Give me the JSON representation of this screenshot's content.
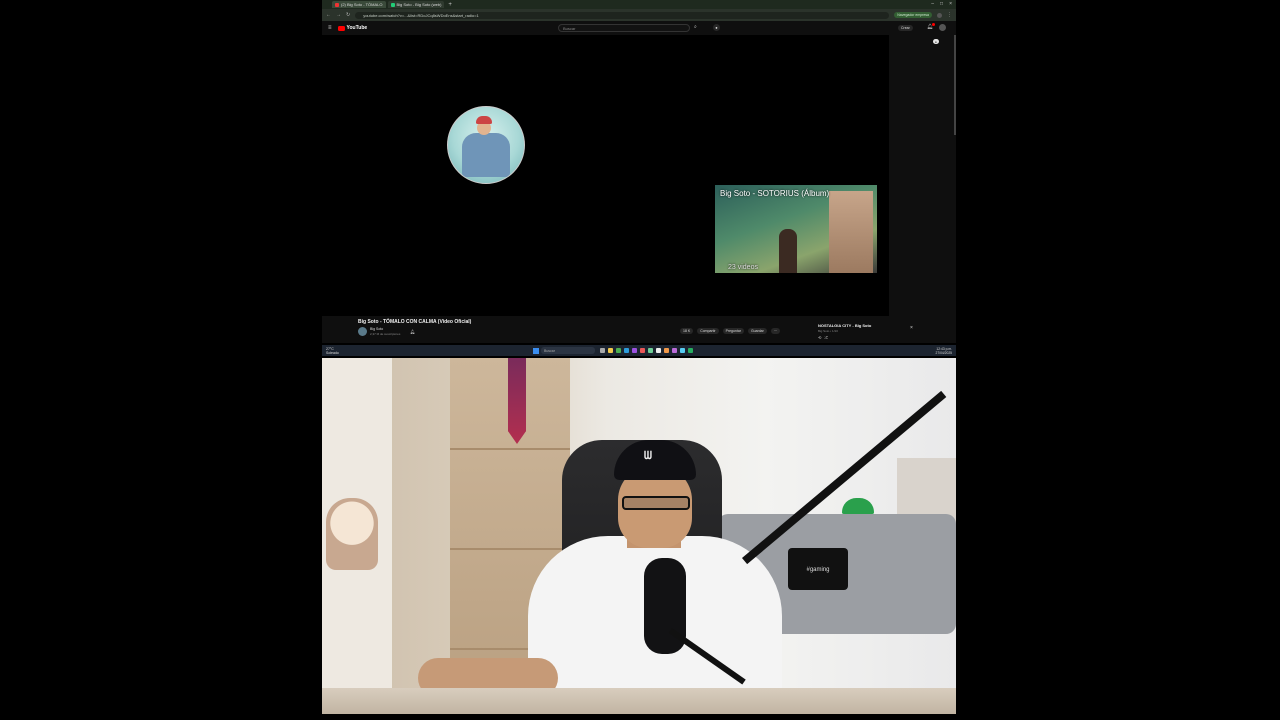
{
  "browser": {
    "tabs": [
      {
        "label": "(2) Big Soto - TÓMALO",
        "active": true
      },
      {
        "label": "Big Soto - Big Soto (web)",
        "active": false
      }
    ],
    "url": "youtube.com/watch?v=...&list=RDoJCq8sWDoEns&start_radio=1",
    "ext_pill": "Navegador empresa"
  },
  "youtube": {
    "logo_text": "YouTube",
    "search_placeholder": "Buscar",
    "share_label": "Crear",
    "endscreen_card": {
      "title": "Big Soto - SOTORIUS (Álbum)",
      "count": "23 videos"
    },
    "video_title": "Big Soto - TÓMALO CON CALMA (Video Oficial)",
    "channel_name": "Big Soto",
    "channel_subs": "2,37 M de suscriptores",
    "actions": [
      "18 K",
      "Compartir",
      "Preguntar",
      "Guardar",
      "···"
    ],
    "mini_title": "NOSTALGIA CITY - Big Soto",
    "mini_sub": "Big Soto • 1/10"
  },
  "taskbar": {
    "weather_temp": "27°C",
    "weather_desc": "Soleado",
    "search_label": "Buscar",
    "time": "12:43 p.m.",
    "date": "27/04/2025"
  },
  "webcam": {
    "pillow_text": "#gaming"
  },
  "colors": {
    "youtube_red": "#ff0000",
    "page_bg": "#0f0f0f",
    "taskbar_bg": "#1c2430"
  }
}
